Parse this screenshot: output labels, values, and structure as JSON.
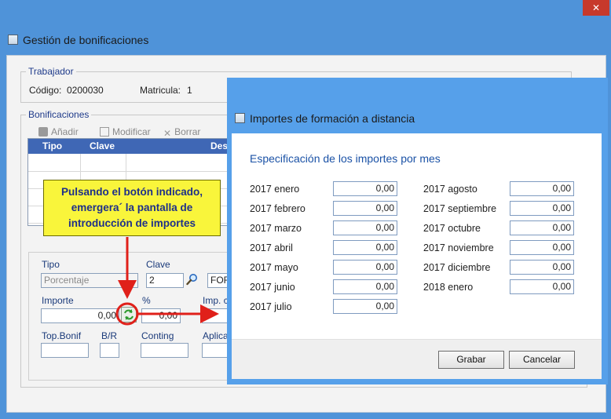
{
  "outer_window": {
    "title": "Gestión de bonificaciones",
    "close_glyph": "✕"
  },
  "trabajador": {
    "group_title": "Trabajador",
    "codigo_label": "Código:",
    "codigo_value": "0200030",
    "matricula_label": "Matricula:",
    "matricula_value": "1"
  },
  "bonificaciones": {
    "group_title": "Bonificaciones",
    "toolbar": {
      "add_label": "Añadir",
      "modify_label": "Modificar",
      "delete_label": "Borrar"
    },
    "grid_headers": [
      "Tipo",
      "Clave",
      "Des"
    ]
  },
  "form": {
    "tipo_label": "Tipo",
    "tipo_value": "Porcentaje",
    "clave_label": "Clave",
    "clave_value": "2",
    "desc_value": "FOR",
    "importe_label": "Importe",
    "importe_value": "0,00",
    "percent_label": "%",
    "percent_value": "0,00",
    "imp_label": "Imp. c",
    "top_bonif_label": "Top.Bonif",
    "br_label": "B/R",
    "conting_label": "Conting",
    "aplica_label": "Aplica"
  },
  "callout": {
    "lines": [
      "Pulsando el botón indicado,",
      "emergera´ la pantalla de",
      "introducción de importes"
    ]
  },
  "dialog": {
    "title": "Importes de formación a distancia",
    "heading": "Especificación de los importes por mes",
    "months_left": [
      {
        "label": "2017 enero",
        "value": "0,00"
      },
      {
        "label": "2017 febrero",
        "value": "0,00"
      },
      {
        "label": "2017 marzo",
        "value": "0,00"
      },
      {
        "label": "2017 abril",
        "value": "0,00"
      },
      {
        "label": "2017 mayo",
        "value": "0,00"
      },
      {
        "label": "2017 junio",
        "value": "0,00"
      },
      {
        "label": "2017 julio",
        "value": "0,00"
      }
    ],
    "months_right": [
      {
        "label": "2017 agosto",
        "value": "0,00"
      },
      {
        "label": "2017 septiembre",
        "value": "0,00"
      },
      {
        "label": "2017 octubre",
        "value": "0,00"
      },
      {
        "label": "2017 noviembre",
        "value": "0,00"
      },
      {
        "label": "2017 diciembre",
        "value": "0,00"
      },
      {
        "label": "2018 enero",
        "value": "0,00"
      }
    ],
    "save_label": "Grabar",
    "cancel_label": "Cancelar"
  },
  "colors": {
    "window_frame": "#4f93d9",
    "dialog_frame": "#56a0ea",
    "callout_bg": "#f9f53b",
    "arrow_red": "#e0201a",
    "grid_header": "#3f67b5"
  }
}
